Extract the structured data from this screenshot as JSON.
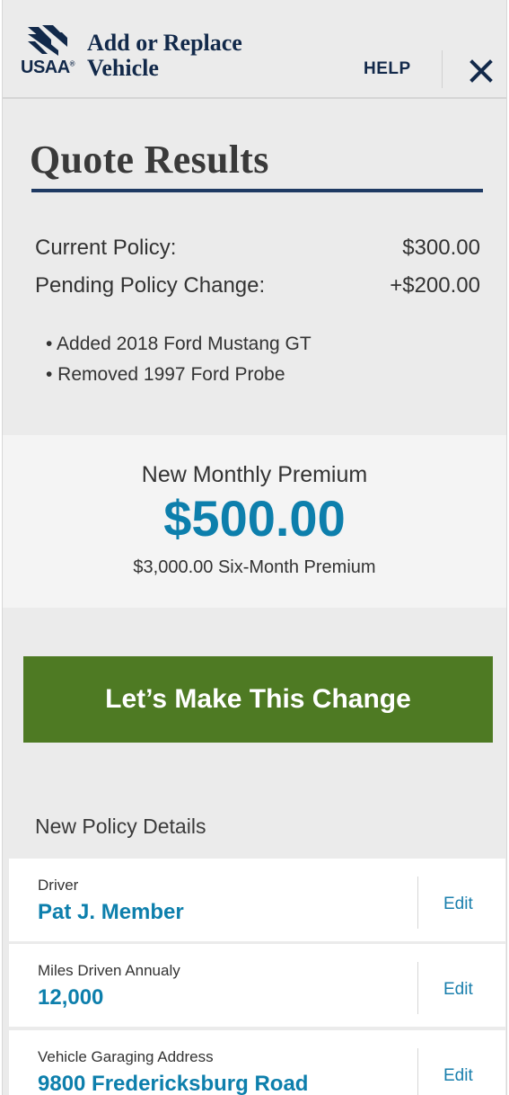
{
  "header": {
    "brand": "USAA",
    "title_line1": "Add or Replace",
    "title_line2": "Vehicle",
    "help": "HELP",
    "close_icon": "close-icon"
  },
  "quote": {
    "title": "Quote Results",
    "current_label": "Current Policy:",
    "current_value": "$300.00",
    "pending_label": "Pending Policy Change:",
    "pending_value": "+$200.00",
    "changes": [
      "• Added 2018 Ford Mustang GT",
      "• Removed 1997 Ford Probe"
    ]
  },
  "premium": {
    "label": "New Monthly Premium",
    "amount": "$500.00",
    "six_month": "$3,000.00 Six-Month Premium"
  },
  "cta": {
    "label": "Let’s Make This Change"
  },
  "details": {
    "heading": "New Policy Details",
    "items": [
      {
        "label": "Driver",
        "value": "Pat J. Member",
        "edit": "Edit"
      },
      {
        "label": "Miles Driven Annualy",
        "value": "12,000",
        "edit": "Edit"
      },
      {
        "label": "Vehicle Garaging Address",
        "value": "9800 Fredericksburg Road",
        "edit": "Edit"
      }
    ]
  },
  "colors": {
    "navy": "#12294a",
    "accent_blue": "#0d7fac",
    "cta_green": "#4e7a23"
  }
}
